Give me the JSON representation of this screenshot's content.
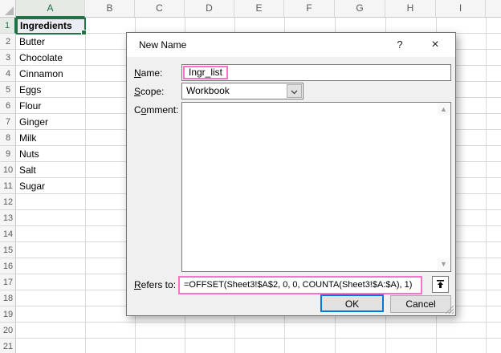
{
  "spreadsheet": {
    "column_headers": [
      "A",
      "B",
      "C",
      "D",
      "E",
      "F",
      "G",
      "H",
      "I"
    ],
    "selected_column": "A",
    "row_headers": [
      "1",
      "2",
      "3",
      "4",
      "5",
      "6",
      "7",
      "8",
      "9",
      "10",
      "11",
      "12",
      "13",
      "14",
      "15",
      "16",
      "17",
      "18",
      "19",
      "20",
      "21"
    ],
    "selected_row": "1",
    "column_a_cells": [
      "Ingredients",
      "Butter",
      "Chocolate",
      "Cinnamon",
      "Eggs",
      "Flour",
      "Ginger",
      "Milk",
      "Nuts",
      "Salt",
      "Sugar"
    ],
    "active_cell_value": "Ingredients",
    "accent_green": "#217346"
  },
  "dialog": {
    "title": "New Name",
    "help_glyph": "?",
    "close_glyph": "×",
    "fields": {
      "name": {
        "label": {
          "accel": "N",
          "post": "ame:"
        },
        "value": "Ingr_list"
      },
      "scope": {
        "label": {
          "accel": "S",
          "post": "cope:"
        },
        "value": "Workbook"
      },
      "comment": {
        "label": {
          "pre": "C",
          "accel": "o",
          "post": "mment:"
        },
        "value": ""
      },
      "refers_to": {
        "label": {
          "accel": "R",
          "post": "efers to:"
        },
        "value": "=OFFSET(Sheet3!$A$2, 0, 0, COUNTA(Sheet3!$A:$A), 1)"
      }
    },
    "scrollbar": {
      "up_glyph": "▲",
      "down_glyph": "▼"
    },
    "buttons": {
      "ok": "OK",
      "cancel": "Cancel"
    },
    "highlight_color": "#FB71CB",
    "focus_color": "#0078D7"
  }
}
